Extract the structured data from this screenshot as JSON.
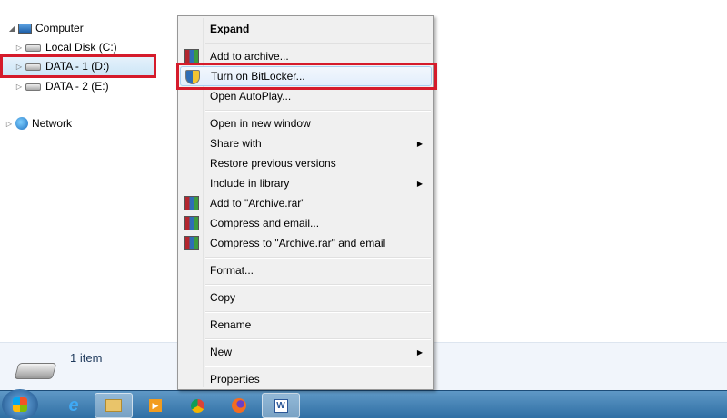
{
  "tree": {
    "items": [
      {
        "label": "Computer",
        "icon": "computer-icon"
      },
      {
        "label": "Local Disk (C:)",
        "icon": "windows-drive-icon"
      },
      {
        "label": "DATA - 1 (D:)",
        "icon": "drive-icon",
        "selected": true
      },
      {
        "label": "DATA - 2 (E:)",
        "icon": "drive-icon"
      },
      {
        "label": "Network",
        "icon": "network-icon"
      }
    ]
  },
  "status": {
    "count": "1 item"
  },
  "menu": {
    "items": [
      {
        "label": "Expand",
        "bold": true
      },
      {
        "label": "Add to archive...",
        "icon": "winrar-icon"
      },
      {
        "label": "Turn on BitLocker...",
        "icon": "shield-icon",
        "highlighted": true
      },
      {
        "label": "Open AutoPlay..."
      },
      {
        "label": "Open in new window"
      },
      {
        "label": "Share with",
        "submenu": true
      },
      {
        "label": "Restore previous versions"
      },
      {
        "label": "Include in library",
        "submenu": true
      },
      {
        "label": "Add to \"Archive.rar\"",
        "icon": "winrar-icon"
      },
      {
        "label": "Compress and email...",
        "icon": "winrar-icon"
      },
      {
        "label": "Compress to \"Archive.rar\" and email",
        "icon": "winrar-icon"
      },
      {
        "label": "Format..."
      },
      {
        "label": "Copy"
      },
      {
        "label": "Rename"
      },
      {
        "label": "New",
        "submenu": true
      },
      {
        "label": "Properties"
      }
    ]
  },
  "taskbar": {
    "apps": [
      "start",
      "internet-explorer",
      "windows-explorer",
      "media-player",
      "chrome",
      "firefox",
      "word"
    ]
  },
  "colors": {
    "highlight_box": "#d51b2b",
    "taskbar": "#3f7fb4"
  }
}
